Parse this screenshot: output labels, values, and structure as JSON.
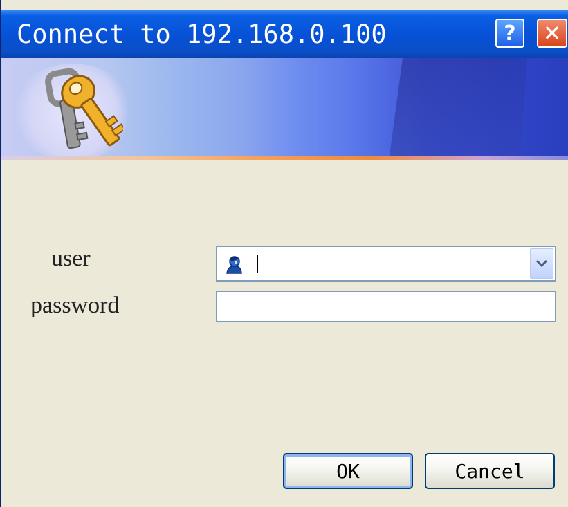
{
  "window": {
    "title": "Connect to 192.168.0.100"
  },
  "titlebar": {
    "help_label": "?",
    "close_label": "✕"
  },
  "form": {
    "user_label": "user",
    "password_label": "password",
    "user_value": "",
    "password_value": ""
  },
  "buttons": {
    "ok_label": "OK",
    "cancel_label": "Cancel"
  },
  "colors": {
    "titlebar": "#0751d6",
    "dialog_bg": "#ece9d8",
    "input_border": "#7f9db9",
    "button_border": "#003c74"
  },
  "icons": {
    "banner": "keys-icon",
    "user_field": "user-icon",
    "dropdown": "chevron-down-icon"
  }
}
